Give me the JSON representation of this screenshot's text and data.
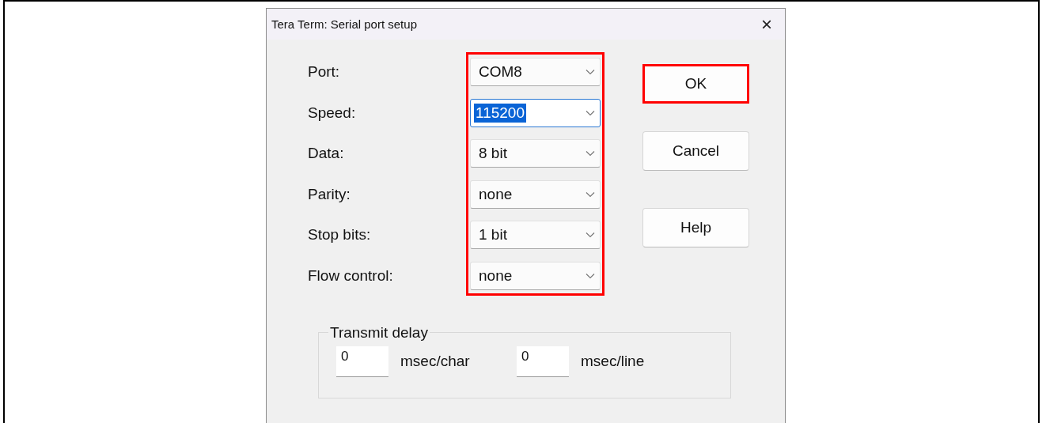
{
  "window": {
    "title": "Tera Term: Serial port setup",
    "close": "×"
  },
  "fields_highlighted": true,
  "fields": [
    {
      "label": "Port:",
      "value": "COM8",
      "focused": false
    },
    {
      "label": "Speed:",
      "value": "115200",
      "focused": true
    },
    {
      "label": "Data:",
      "value": "8 bit",
      "focused": false
    },
    {
      "label": "Parity:",
      "value": "none",
      "focused": false
    },
    {
      "label": "Stop bits:",
      "value": "1 bit",
      "focused": false
    },
    {
      "label": "Flow control:",
      "value": "none",
      "focused": false
    }
  ],
  "buttons": [
    {
      "label": "OK",
      "highlighted": true
    },
    {
      "label": "Cancel",
      "highlighted": false
    },
    {
      "label": "Help",
      "highlighted": false
    }
  ],
  "transmit_delay": {
    "title": "Transmit delay",
    "inputs": [
      {
        "value": "0",
        "unit": "msec/char"
      },
      {
        "value": "0",
        "unit": "msec/line"
      }
    ]
  }
}
